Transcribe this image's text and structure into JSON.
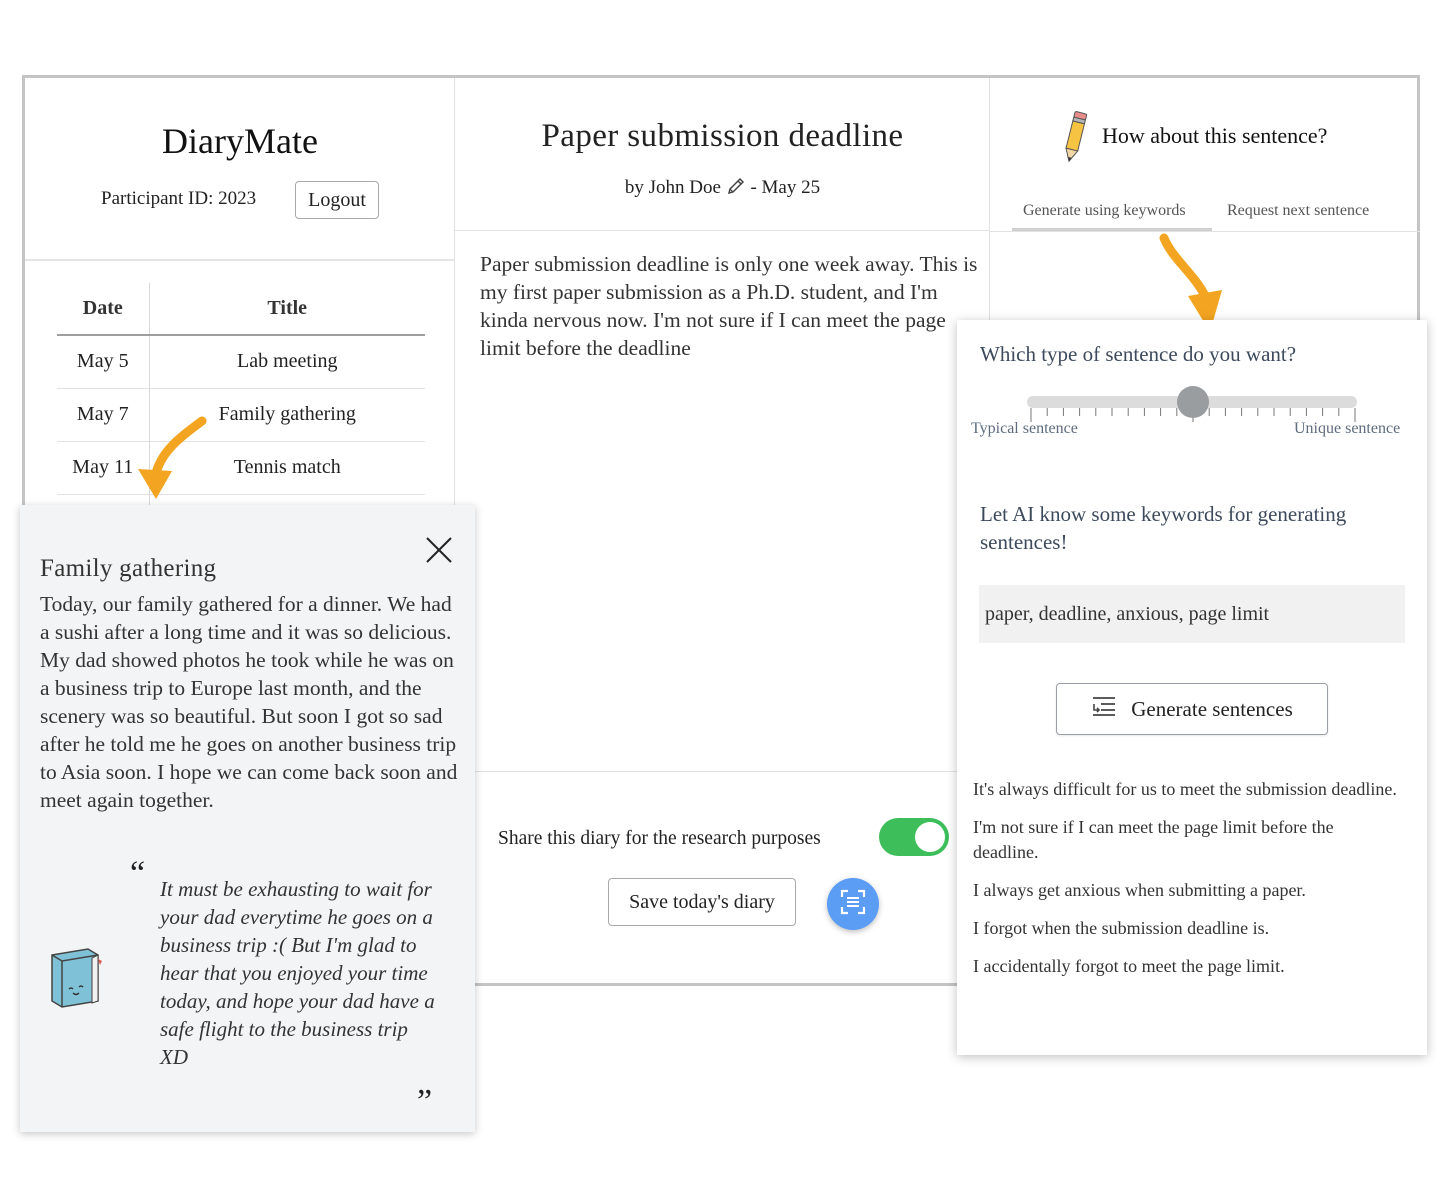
{
  "left": {
    "app_title": "DiaryMate",
    "participant_label": "Participant ID: 2023",
    "logout_label": "Logout",
    "table": {
      "headers": [
        "Date",
        "Title"
      ],
      "rows": [
        {
          "date": "May 5",
          "title": "Lab meeting"
        },
        {
          "date": "May 7",
          "title": "Family gathering"
        },
        {
          "date": "May 11",
          "title": "Tennis match"
        }
      ]
    }
  },
  "editor": {
    "title": "Paper submission deadline",
    "byline_author": "by John Doe",
    "byline_date": "- May 25",
    "body": "Paper submission deadline is only one week away. This is my first paper submission as a Ph.D. student, and I'm kinda nervous now. I'm not sure if I can meet the page limit before the deadline",
    "share_label": "Share this diary for the research purposes",
    "share_enabled": true,
    "save_label": "Save today's diary"
  },
  "suggest": {
    "heading": "How about this sentence?",
    "tabs": [
      "Generate using keywords",
      "Request next sentence"
    ],
    "active_tab": 0
  },
  "popup": {
    "title": "Family gathering",
    "body": "Today, our family gathered for a dinner. We had a sushi after a long time and it was so delicious. My dad showed photos he took while he was on a business trip to Europe last month, and the scenery was so beautiful. But soon I got so sad after he told me he goes on another business trip to Asia soon. I hope we can come back soon and meet again together.",
    "quote_open": "“",
    "quote": "It must be exhausting to wait for your dad everytime he goes on a business trip :( But I'm glad to hear that you enjoyed your time today, and hope your dad have a safe flight to the business trip XD",
    "quote_close": "”",
    "close_label": "X"
  },
  "generator": {
    "question": "Which type of sentence do you want?",
    "slider_left_label": "Typical sentence",
    "slider_right_label": "Unique sentence",
    "slider_value": 0.5,
    "keywords_prompt": "Let AI know some keywords for generating sentences!",
    "keywords_value": "paper, deadline, anxious, page limit",
    "generate_label": "Generate sentences",
    "sentences": [
      "It's always difficult for us to meet the submission deadline.",
      "I'm not sure if I can meet the page limit before the deadline.",
      "I always get anxious when submitting a paper.",
      "I forgot when the submission deadline is.",
      "I accidentally forgot to meet the page limit."
    ]
  },
  "colors": {
    "accent_arrow": "#f3a521",
    "toggle_on": "#3dbe5a",
    "scan_button": "#5b9cf5"
  },
  "icons": [
    "pencil-icon",
    "scan-icon",
    "close-icon",
    "generate-lines-icon",
    "book-mascot-icon",
    "pencil-emoji-icon"
  ]
}
